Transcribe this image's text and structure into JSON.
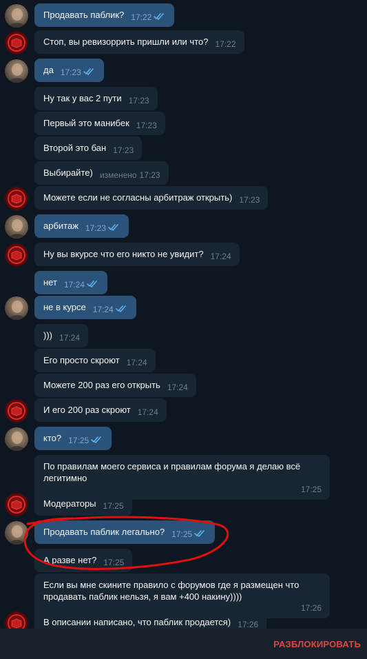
{
  "messages": [
    {
      "text": "Продавать паблик?",
      "time": "17:22",
      "out": true,
      "read": true,
      "avatar": "user"
    },
    {
      "text": "Стоп, вы ревизоррить пришли или что?",
      "time": "17:22",
      "out": false,
      "avatar": "bot"
    },
    {
      "text": "да",
      "time": "17:23",
      "out": true,
      "read": true,
      "avatar": "user"
    },
    {
      "text": "Ну так у вас 2 пути",
      "time": "17:23",
      "out": false
    },
    {
      "text": "Первый это манибек",
      "time": "17:23",
      "out": false
    },
    {
      "text": "Второй это бан",
      "time": "17:23",
      "out": false
    },
    {
      "text": "Выбирайте)",
      "time": "17:23",
      "out": false,
      "edited": "изменено"
    },
    {
      "text": "Можете если не согласны арбитраж открыть)",
      "time": "17:23",
      "out": false,
      "avatar": "bot"
    },
    {
      "text": "арбитаж",
      "time": "17:23",
      "out": true,
      "read": true,
      "avatar": "user"
    },
    {
      "text": "Ну вы вкурсе что его никто не увидит?",
      "time": "17:24",
      "out": false,
      "avatar": "bot"
    },
    {
      "text": "нет",
      "time": "17:24",
      "out": true,
      "read": true
    },
    {
      "text": "не в курсе",
      "time": "17:24",
      "out": true,
      "read": true,
      "avatar": "user"
    },
    {
      "text": ")))",
      "time": "17:24",
      "out": false
    },
    {
      "text": "Его просто скроют",
      "time": "17:24",
      "out": false
    },
    {
      "text": "Можете 200 раз его открыть",
      "time": "17:24",
      "out": false
    },
    {
      "text": "И его 200 раз скроют",
      "time": "17:24",
      "out": false,
      "avatar": "bot"
    },
    {
      "text": "кто?",
      "time": "17:25",
      "out": true,
      "read": true,
      "avatar": "user"
    },
    {
      "text": "По правилам моего сервиса и правилам форума я делаю всё легитимно",
      "time": "17:25",
      "out": false
    },
    {
      "text": "Модераторы",
      "time": "17:25",
      "out": false,
      "avatar": "bot"
    },
    {
      "text": "Продавать паблик легально?",
      "time": "17:25",
      "out": true,
      "read": true,
      "avatar": "user"
    },
    {
      "text": "А разве нет?",
      "time": "17:25",
      "out": false
    },
    {
      "text": "Если вы мне скините правило с форумов где я размещен что продавать паблик нельзя, я вам +400 накину))))",
      "time": "17:26",
      "out": false
    },
    {
      "text": "В описании написано, что паблик продается)",
      "time": "17:26",
      "out": false,
      "avatar": "bot"
    }
  ],
  "footer": {
    "unblock_label": "РАЗБЛОКИРОВАТЬ"
  },
  "colors": {
    "background": "#0e1621",
    "incoming_bubble": "#182533",
    "outgoing_bubble": "#2b5278",
    "read_check": "#5fb0ee",
    "unblock": "#e0463f",
    "highlight_scribble": "#e01010"
  },
  "icons": {
    "read_receipt": "double-check-icon",
    "avatar_user": "user-avatar",
    "avatar_bot": "bot-avatar"
  }
}
